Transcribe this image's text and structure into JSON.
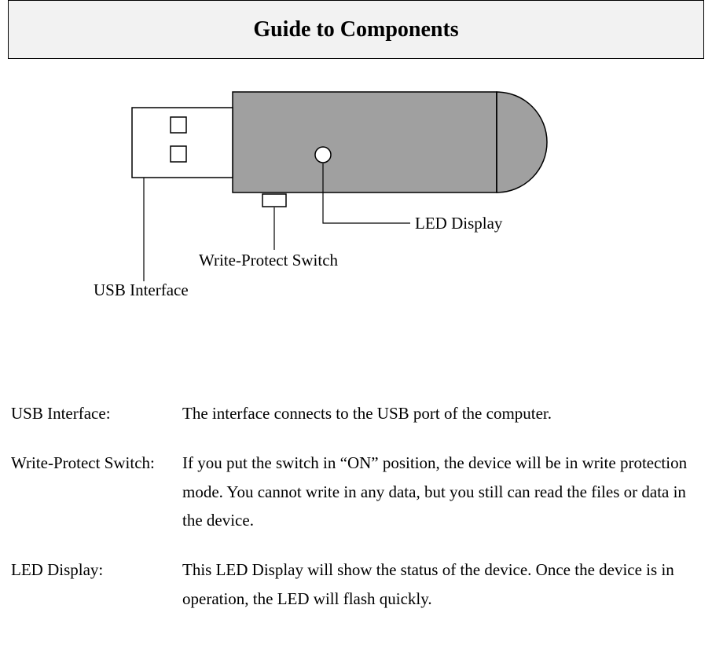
{
  "title": "Guide to Components",
  "labels": {
    "led": "LED Display",
    "wps": "Write-Protect Switch",
    "usb": "USB Interface"
  },
  "definitions": [
    {
      "term": "USB Interface:",
      "text": "The interface connects to the USB port of the computer."
    },
    {
      "term": "Write-Protect Switch:",
      "text": "If you put the switch in “ON” position, the device will be in write protection mode. You cannot write in any data, but you still can read the files or data in the device."
    },
    {
      "term": "LED Display:",
      "text": "This LED Display will show the status of the device. Once the device is in operation, the LED will flash quickly."
    }
  ]
}
